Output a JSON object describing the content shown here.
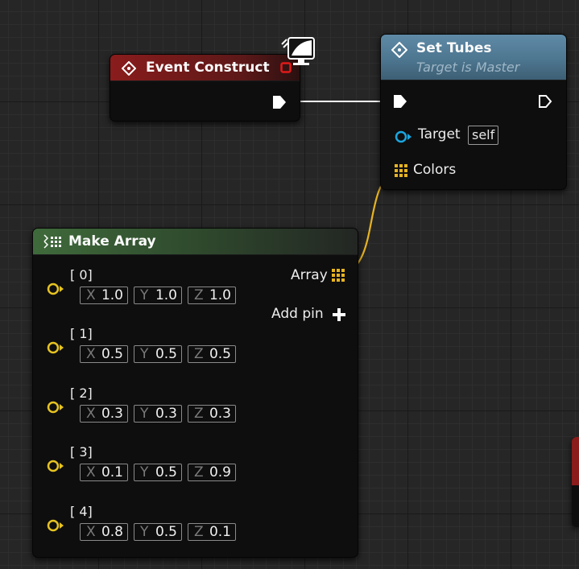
{
  "event_node": {
    "title": "Event Construct"
  },
  "set_tubes_node": {
    "title": "Set Tubes",
    "subtitle": "Target is Master",
    "target_label": "Target",
    "target_default": "self",
    "colors_label": "Colors"
  },
  "make_array_node": {
    "title": "Make Array",
    "output_label": "Array",
    "add_pin_label": "Add pin",
    "add_pin_icon": "plus-icon",
    "elements": [
      {
        "label": "[ 0]",
        "x": "1.0",
        "y": "1.0",
        "z": "1.0"
      },
      {
        "label": "[ 1]",
        "x": "0.5",
        "y": "0.5",
        "z": "0.5"
      },
      {
        "label": "[ 2]",
        "x": "0.3",
        "y": "0.3",
        "z": "0.3"
      },
      {
        "label": "[ 3]",
        "x": "0.1",
        "y": "0.5",
        "z": "0.9"
      },
      {
        "label": "[ 4]",
        "x": "0.8",
        "y": "0.5",
        "z": "0.1"
      }
    ]
  },
  "axis_labels": {
    "x": "X",
    "y": "Y",
    "z": "Z"
  },
  "colors": {
    "event_header": "#8a1c1c",
    "function_header": "#4d7690",
    "pure_header": "#3f6a3b",
    "exec_wire": "#ffffff",
    "array_wire": "#e7b421",
    "vector_pin": "#e6c321",
    "object_pin": "#1aa6e0",
    "delegate_pin": "#e01a1a",
    "background": "#262626"
  }
}
